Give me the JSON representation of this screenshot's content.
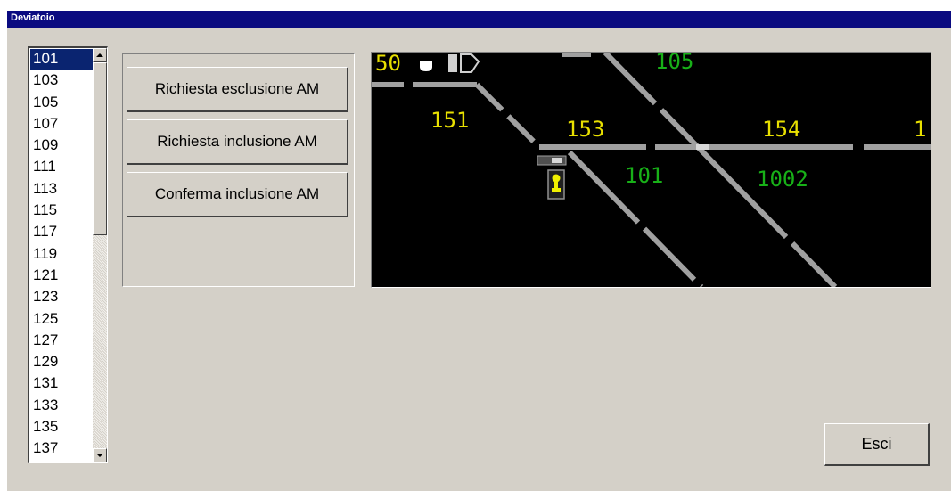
{
  "window": {
    "title": "Deviatoio"
  },
  "list": {
    "selected": "101",
    "items": [
      "101",
      "103",
      "105",
      "107",
      "109",
      "111",
      "113",
      "115",
      "117",
      "119",
      "121",
      "123",
      "125",
      "127",
      "129",
      "131",
      "133",
      "135",
      "137"
    ]
  },
  "buttons": {
    "request_exclusion": "Richiesta esclusione AM",
    "request_inclusion": "Richiesta inclusione AM",
    "confirm_inclusion": "Conferma inclusione AM",
    "exit": "Esci"
  },
  "map": {
    "labels": {
      "partial_left": "50",
      "top_105": "105",
      "s151": "151",
      "s153": "153",
      "s154": "154",
      "partial_right": "1",
      "sw101": "101",
      "s1002": "1002"
    },
    "colors": {
      "background": "#000000",
      "track": "#a0a0a0",
      "label_yellow": "#e8e000",
      "label_green": "#18b018",
      "signal": "#f0f000"
    }
  }
}
